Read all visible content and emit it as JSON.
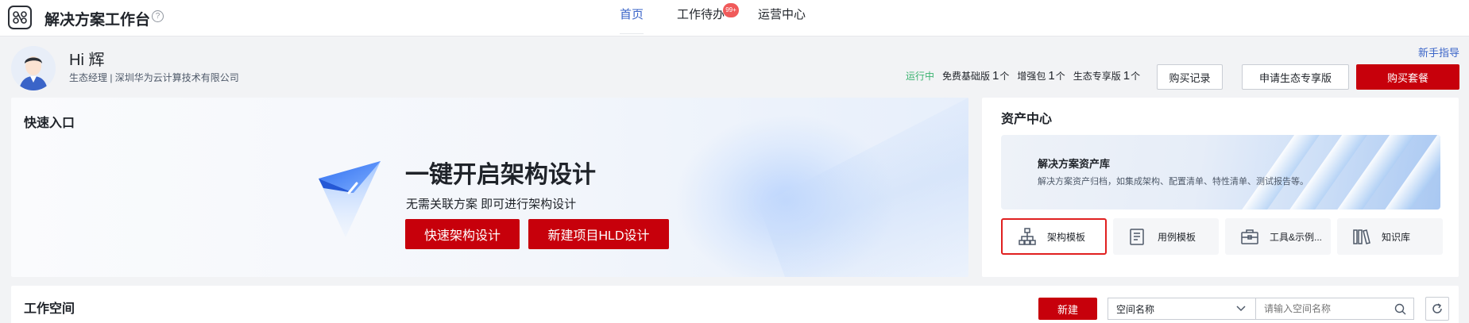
{
  "app": {
    "title": "解决方案工作台"
  },
  "nav": {
    "items": [
      {
        "label": "首页",
        "active": true
      },
      {
        "label": "工作待办",
        "badge": "99+"
      },
      {
        "label": "运营中心"
      }
    ]
  },
  "user": {
    "greeting": "Hi 辉",
    "role_line": "生态经理 | 深圳华为云计算技术有限公司"
  },
  "guide_link": "新手指导",
  "status": {
    "running": "运行中",
    "items": [
      {
        "label": "免费基础版",
        "count": "1",
        "unit": "个"
      },
      {
        "label": "增强包",
        "count": "1",
        "unit": "个"
      },
      {
        "label": "生态专享版",
        "count": "1",
        "unit": "个"
      }
    ]
  },
  "actions": {
    "purchase_record": "购买记录",
    "apply_exclusive": "申请生态专享版",
    "buy_package": "购买套餐"
  },
  "quick_entry": {
    "title": "快速入口",
    "hero_title": "一键开启架构设计",
    "hero_sub": "无需关联方案 即可进行架构设计",
    "btn_quick": "快速架构设计",
    "btn_hld": "新建项目HLD设计"
  },
  "asset_center": {
    "title": "资产中心",
    "library_name": "解决方案资产库",
    "library_desc": "解决方案资产归档，如集成架构、配置清单、特性清单、测试报告等。",
    "tiles": [
      {
        "label": "架构模板",
        "icon": "architecture-icon",
        "selected": true
      },
      {
        "label": "用例模板",
        "icon": "document-list-icon"
      },
      {
        "label": "工具&示例...",
        "icon": "toolbox-icon"
      },
      {
        "label": "知识库",
        "icon": "books-icon"
      }
    ]
  },
  "workspace": {
    "title": "工作空间",
    "new_label": "新建",
    "select_value": "空间名称",
    "search_placeholder": "请输入空间名称"
  },
  "colors": {
    "brand_red": "#c7000b",
    "link_blue": "#3a64c8",
    "running_green": "#3cb371"
  }
}
